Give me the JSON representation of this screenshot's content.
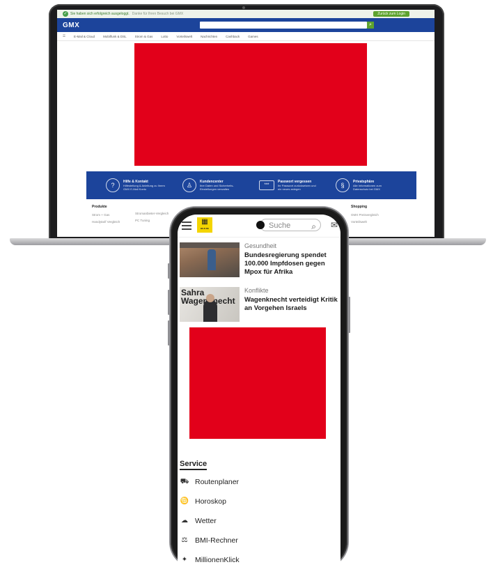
{
  "desktop": {
    "notice": "Sie haben sich erfolgreich ausgeloggt.",
    "notice_sub": "Danke für Ihren Besuch bei GMX",
    "login_label": "Zurück zum Login",
    "logo": "GMX",
    "nav": [
      "E-Mail & Cloud",
      "Mobilfunk & DSL",
      "Strom & Gas",
      "Lotto",
      "Vorteilswelt",
      "Nachrichten",
      "Cashback",
      "Games"
    ],
    "services": [
      {
        "icon": "?",
        "title": "Hilfe & Kontakt",
        "text": "Hilfestellung & Anleitung zu Ihrem GMX E-Mail Konto"
      },
      {
        "icon": "♙",
        "title": "Kundencenter",
        "text": "Ihre Daten und Sicherheits-Einstellungen verwalten"
      },
      {
        "icon": "***",
        "title": "Passwort vergessen",
        "text": "Ihr Passwort zurücksetzen und ein neues anlegen"
      },
      {
        "icon": "§",
        "title": "Privatsphäre",
        "text": "Alle Informationen zum Datenschutz bei GMX"
      }
    ],
    "footer": {
      "col1_head": "Produkte",
      "col1_links": [
        "Strom + Gas",
        "Handytarif Vergleich"
      ],
      "col2_links": [
        "Stromanbieter-Vergleich",
        "PC Tuning"
      ],
      "col3_head": "Shopping",
      "col3_links": [
        "GMX Preisvergleich",
        "Vorteilswelt"
      ]
    }
  },
  "mobile": {
    "logo_text": "BILD.DE",
    "search_placeholder": "Suche",
    "articles": [
      {
        "category": "Gesundheit",
        "title": "Bundesregierung spendet 100.000 Impfdosen gegen Mpox für Afrika"
      },
      {
        "category": "Konflikte",
        "title": "Wagenknecht verteidigt Kritik an Vorgehen Israels",
        "thumb_text": "Sahra Wagenknecht"
      }
    ],
    "service_heading": "Service",
    "service_items": [
      {
        "label": "Routenplaner",
        "icon": "car-icon"
      },
      {
        "label": "Horoskop",
        "icon": "horoscope-icon"
      },
      {
        "label": "Wetter",
        "icon": "weather-icon"
      },
      {
        "label": "BMI-Rechner",
        "icon": "bmi-icon"
      },
      {
        "label": "MillionenKlick",
        "icon": "lottery-icon"
      }
    ]
  },
  "colors": {
    "ad_red": "#e2001a",
    "gmx_blue": "#1c449b",
    "gmx_green": "#5ea32e"
  }
}
